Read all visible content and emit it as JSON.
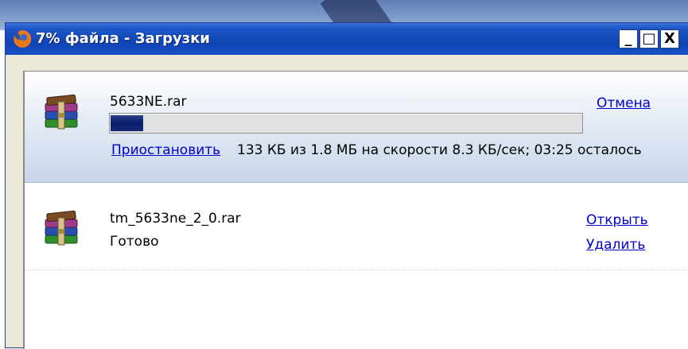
{
  "window": {
    "title": "7% файла - Загрузки",
    "icon": "firefox-icon",
    "controls": {
      "minimize": "_",
      "maximize": "□",
      "close": "X"
    }
  },
  "downloads": [
    {
      "filename": "5633NE.rar",
      "icon": "winrar-archive-icon",
      "progress_percent": 7,
      "progress_text": "133 КБ из 1.8 МБ на скорости 8.3 КБ/сек; 03:25 осталось",
      "cancel_label": "Отмена",
      "pause_label": "Приостановить"
    },
    {
      "filename": "tm_5633ne_2_0.rar",
      "icon": "winrar-archive-icon",
      "status": "Готово",
      "open_label": "Открыть",
      "delete_label": "Удалить"
    }
  ],
  "colors": {
    "titlebar": "#0f44b3",
    "link": "#0000cc",
    "progress_fill": "#0a1f6b",
    "active_item_bg": "#c8d6ea"
  }
}
